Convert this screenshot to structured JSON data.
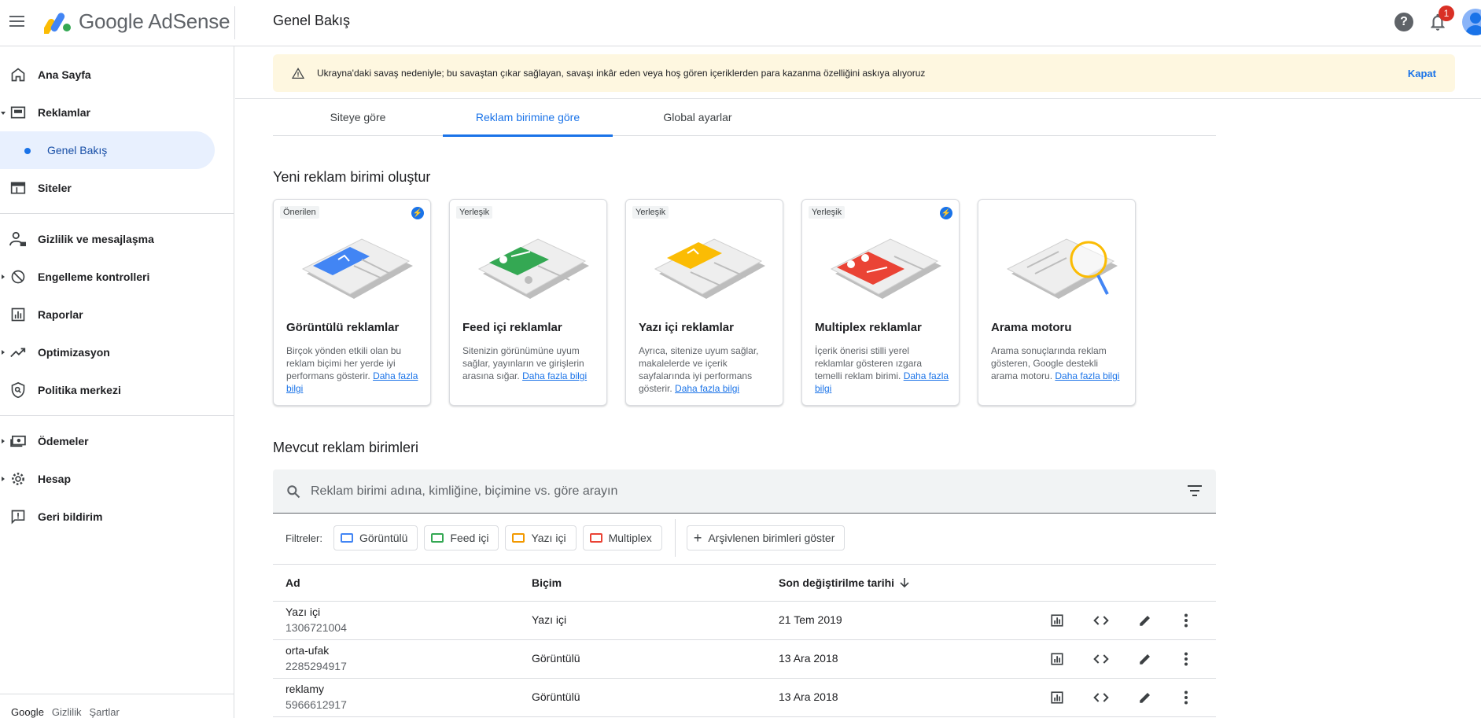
{
  "header": {
    "app_name": "Google AdSense",
    "page_title": "Genel Bakış",
    "notification_count": "1"
  },
  "sidebar": {
    "items": [
      {
        "label": "Ana Sayfa",
        "icon": "home-icon"
      },
      {
        "label": "Reklamlar",
        "icon": "ads-icon"
      },
      {
        "label": "Genel Bakış",
        "icon": "dot-icon"
      },
      {
        "label": "Siteler",
        "icon": "sites-icon"
      },
      {
        "label": "Gizlilik ve mesajlaşma",
        "icon": "privacy-icon"
      },
      {
        "label": "Engelleme kontrolleri",
        "icon": "block-icon"
      },
      {
        "label": "Raporlar",
        "icon": "reports-icon"
      },
      {
        "label": "Optimizasyon",
        "icon": "trending-icon"
      },
      {
        "label": "Politika merkezi",
        "icon": "policy-icon"
      },
      {
        "label": "Ödemeler",
        "icon": "payments-icon"
      },
      {
        "label": "Hesap",
        "icon": "gear-icon"
      },
      {
        "label": "Geri bildirim",
        "icon": "feedback-icon"
      }
    ],
    "footer": [
      "Google",
      "Gizlilik",
      "Şartlar"
    ]
  },
  "banner": {
    "message": "Ukrayna'daki savaş nedeniyle; bu savaştan çıkar sağlayan, savaşı inkâr eden veya hoş gören içeriklerden para kazanma özelliğini askıya alıyoruz",
    "close_label": "Kapat"
  },
  "tabs": [
    "Siteye göre",
    "Reklam birimine göre",
    "Global ayarlar"
  ],
  "create_section": {
    "title": "Yeni reklam birimi oluştur",
    "cards": [
      {
        "tag": "Önerilen",
        "title": "Görüntülü reklamlar",
        "desc": "Birçok yönden etkili olan bu reklam biçimi her yerde iyi performans gösterir.",
        "link": "Daha fazla bilgi",
        "color": "#4285f4"
      },
      {
        "tag": "Yerleşik",
        "title": "Feed içi reklamlar",
        "desc": "Sitenizin görünümüne uyum sağlar, yayınların ve girişlerin arasına sığar.",
        "link": "Daha fazla bilgi",
        "color": "#34a853"
      },
      {
        "tag": "Yerleşik",
        "title": "Yazı içi reklamlar",
        "desc": "Ayrıca, sitenize uyum sağlar, makalelerde ve içerik sayfalarında iyi performans gösterir.",
        "link": "Daha fazla bilgi",
        "color": "#fbbc04"
      },
      {
        "tag": "Yerleşik",
        "title": "Multiplex reklamlar",
        "desc": "İçerik önerisi stilli yerel reklamlar gösteren ızgara temelli reklam birimi.",
        "link": "Daha fazla bilgi",
        "color": "#ea4335"
      },
      {
        "tag": "",
        "title": "Arama motoru",
        "desc": "Arama sonuçlarında reklam gösteren, Google destekli arama motoru.",
        "link": "Daha fazla bilgi",
        "color": "#fbbc04"
      }
    ]
  },
  "existing_section": {
    "title": "Mevcut reklam birimleri",
    "search_placeholder": "Reklam birimi adına, kimliğine, biçimine vs. göre arayın",
    "filters_label": "Filtreler:",
    "filters": [
      {
        "label": "Görüntülü",
        "color": "#4285f4"
      },
      {
        "label": "Feed içi",
        "color": "#34a853"
      },
      {
        "label": "Yazı içi",
        "color": "#f29900"
      },
      {
        "label": "Multiplex",
        "color": "#ea4335"
      }
    ],
    "archive_label": "Arşivlenen birimleri göster",
    "columns": [
      "Ad",
      "Biçim",
      "Son değiştirilme tarihi"
    ],
    "rows": [
      {
        "name": "Yazı içi",
        "id": "1306721004",
        "format": "Yazı içi",
        "date": "21 Tem 2019"
      },
      {
        "name": "orta-ufak",
        "id": "2285294917",
        "format": "Görüntülü",
        "date": "13 Ara 2018"
      },
      {
        "name": "reklamy",
        "id": "5966612917",
        "format": "Görüntülü",
        "date": "13 Ara 2018"
      }
    ]
  }
}
